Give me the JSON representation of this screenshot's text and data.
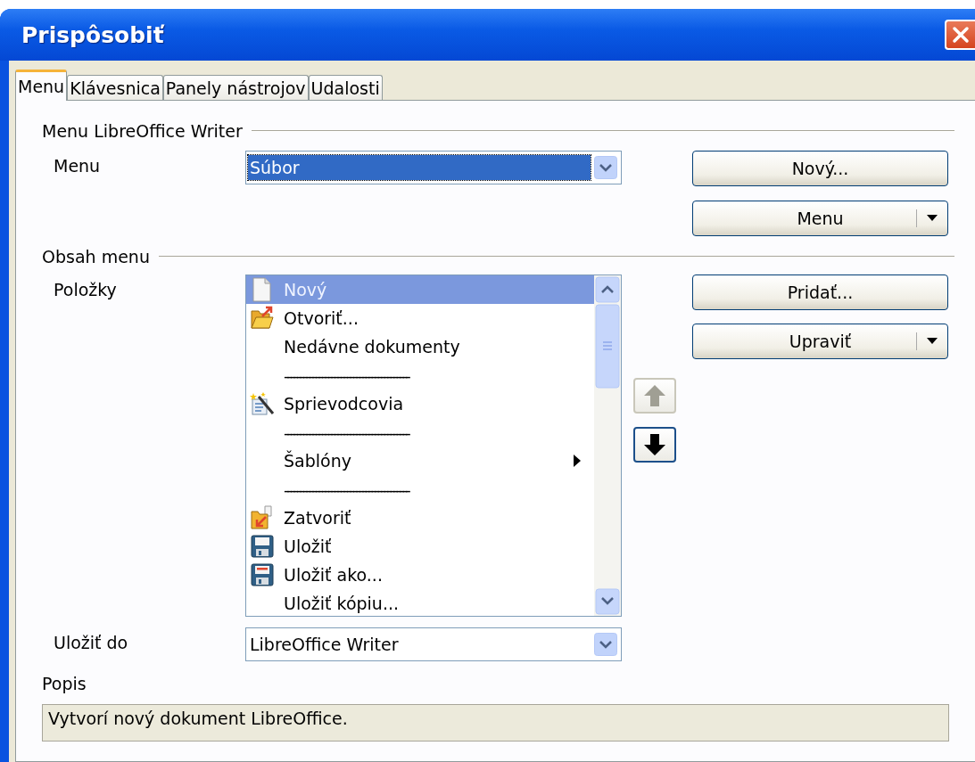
{
  "window": {
    "title": "Prispôsobiť"
  },
  "tabs": [
    {
      "label": "Menu",
      "selected": true
    },
    {
      "label": "Klávesnica",
      "selected": false
    },
    {
      "label": "Panely nástrojov",
      "selected": false
    },
    {
      "label": "Udalosti",
      "selected": false
    }
  ],
  "menu_section": {
    "heading": "Menu LibreOffice Writer",
    "label": "Menu",
    "combo": {
      "value": "Súbor",
      "focused": true
    },
    "buttons": [
      {
        "label": "Nový...",
        "kind": "plain"
      },
      {
        "label": "Menu",
        "kind": "dropdown"
      }
    ]
  },
  "content_section": {
    "heading": "Obsah menu",
    "label": "Položky",
    "items": [
      {
        "label": "Nový",
        "kind": "document",
        "selected": true
      },
      {
        "label": "Otvoriť...",
        "kind": "open",
        "selected": false
      },
      {
        "label": "Nedávne dokumenty",
        "kind": "plain",
        "selected": false
      },
      {
        "label": "----------------------------------------",
        "kind": "separator",
        "selected": false
      },
      {
        "label": "Sprievodcovia",
        "kind": "wizard",
        "selected": false
      },
      {
        "label": "----------------------------------------",
        "kind": "separator",
        "selected": false
      },
      {
        "label": "Šablóny",
        "kind": "submenu",
        "selected": false
      },
      {
        "label": "----------------------------------------",
        "kind": "separator",
        "selected": false
      },
      {
        "label": "Zatvoriť",
        "kind": "close",
        "selected": false
      },
      {
        "label": "Uložiť",
        "kind": "save",
        "selected": false
      },
      {
        "label": "Uložiť ako...",
        "kind": "saveas",
        "selected": false
      },
      {
        "label": "Uložiť kópiu...",
        "kind": "plain",
        "selected": false
      }
    ],
    "move_buttons": [
      {
        "kind": "up",
        "disabled": true
      },
      {
        "kind": "down",
        "disabled": false
      }
    ],
    "buttons": [
      {
        "label": "Pridať...",
        "kind": "plain"
      },
      {
        "label": "Upraviť",
        "kind": "dropdown"
      }
    ]
  },
  "save_to": {
    "label": "Uložiť do",
    "combo": {
      "value": "LibreOffice Writer",
      "focused": false
    }
  },
  "description": {
    "label": "Popis",
    "text": "Vytvorí nový dokument LibreOffice."
  }
}
